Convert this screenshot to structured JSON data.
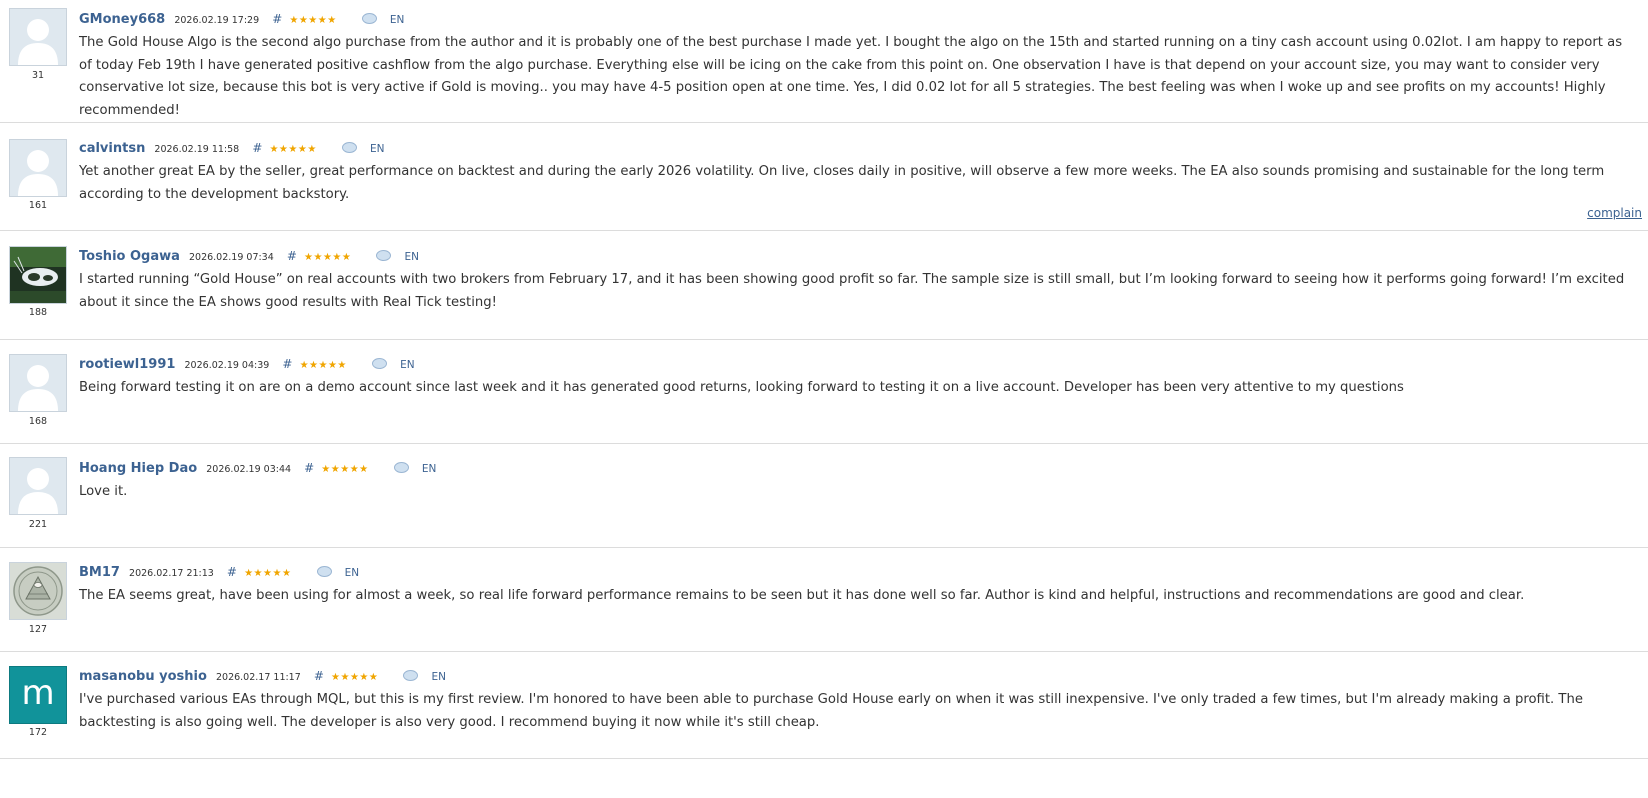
{
  "reviews": [
    {
      "author": "GMoney668",
      "date": "2026.02.19 17:29",
      "hash": "#",
      "stars": "★★★★★",
      "lang": "EN",
      "reputation": "31",
      "text": "The Gold House Algo is the second algo purchase from the author and it is probably one of the best purchase I made yet. I bought the algo on the 15th and started running on a tiny cash account using 0.02lot. I am happy to report as of today Feb 19th I have generated positive cashflow from the algo purchase. Everything else will be icing on the cake from this point on. One observation I have is that depend on your account size, you may want to consider very conservative lot size, because this bot is very active if Gold is moving.. you may have 4-5 position open at one time. Yes, I did 0.02 lot for all 5 strategies. The best feeling was when I woke up and see profits on my accounts! Highly recommended!"
    },
    {
      "author": "calvintsn",
      "date": "2026.02.19 11:58",
      "hash": "#",
      "stars": "★★★★★",
      "lang": "EN",
      "reputation": "161",
      "text": "Yet another great EA by the seller, great performance on backtest and during the early 2026 volatility. On live, closes daily in positive, will observe a few more weeks. The EA also sounds promising and sustainable for the long term according to the development backstory.",
      "complain": "complain"
    },
    {
      "author": "Toshio Ogawa",
      "date": "2026.02.19 07:34",
      "hash": "#",
      "stars": "★★★★★",
      "lang": "EN",
      "reputation": "188",
      "text": "I started running “Gold House” on real accounts with two brokers from February 17, and it has been showing good profit so far. The sample size is still small, but I’m looking forward to seeing how it performs going forward! I’m excited about it since the EA shows good results with Real Tick testing!"
    },
    {
      "author": "rootiewl1991",
      "date": "2026.02.19 04:39",
      "hash": "#",
      "stars": "★★★★★",
      "lang": "EN",
      "reputation": "168",
      "text": "Being forward testing it on are on a demo account since last week and it has generated good returns, looking forward to testing it on a live account. Developer has been very attentive to my questions"
    },
    {
      "author": "Hoang Hiep Dao",
      "date": "2026.02.19 03:44",
      "hash": "#",
      "stars": "★★★★★",
      "lang": "EN",
      "reputation": "221",
      "text": "Love it."
    },
    {
      "author": "BM17",
      "date": "2026.02.17 21:13",
      "hash": "#",
      "stars": "★★★★★",
      "lang": "EN",
      "reputation": "127",
      "text": "The EA seems great, have been using for almost a week, so real life forward performance remains to be seen but it has done well so far. Author is kind and helpful, instructions and recommendations are good and clear."
    },
    {
      "author": "masanobu yoshio",
      "date": "2026.02.17 11:17",
      "hash": "#",
      "stars": "★★★★★",
      "lang": "EN",
      "reputation": "172",
      "avatar_letter": "m",
      "text": "I've purchased various EAs through MQL, but this is my first review. I'm honored to have been able to purchase Gold House early on when it was still inexpensive. I've only traded a few times, but I'm already making a profit. The backtesting is also going well. The developer is also very good. I recommend buying it now while it's still cheap."
    }
  ],
  "colors": {
    "author": "#3c6291",
    "stars": "#f0a500",
    "divider": "#dcdcdc",
    "m_avatar": "#11939a"
  },
  "icons": {
    "avatar_default": "user-silhouette-icon",
    "comment": "speech-bubble-icon"
  }
}
